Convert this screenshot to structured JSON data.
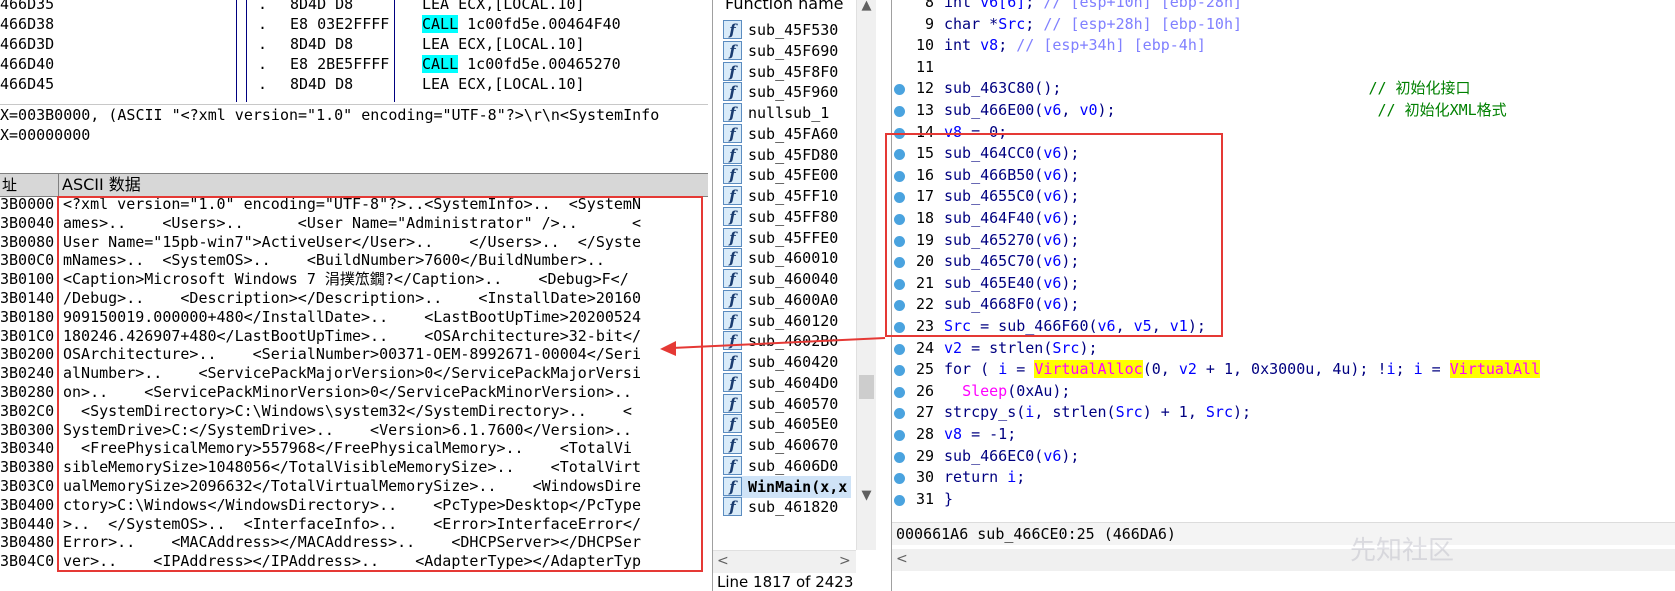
{
  "disasm": [
    {
      "addr": "466D35",
      "mark": ".",
      "bytes": "8D4D D8",
      "mnemonic": "LEA",
      "operands": "ECX,[LOCAL.10]",
      "call": false
    },
    {
      "addr": "466D38",
      "mark": ".",
      "bytes": "E8 03E2FFFF",
      "mnemonic": "CALL",
      "operands": "1c00fd5e.00464F40",
      "call": true
    },
    {
      "addr": "466D3D",
      "mark": ".",
      "bytes": "8D4D D8",
      "mnemonic": "LEA",
      "operands": "ECX,[LOCAL.10]",
      "call": false
    },
    {
      "addr": "466D40",
      "mark": ".",
      "bytes": "E8 2BE5FFFF",
      "mnemonic": "CALL",
      "operands": "1c00fd5e.00465270",
      "call": true
    },
    {
      "addr": "466D45",
      "mark": ".",
      "bytes": "8D4D D8",
      "mnemonic": "LEA",
      "operands": "ECX,[LOCAL.10]",
      "call": false
    }
  ],
  "info": {
    "line1": "X=003B0000, (ASCII \"<?xml version=\"1.0\" encoding=\"UTF-8\"?>\\r\\n<SystemInfo",
    "line2": "X=00000000"
  },
  "dump_header": {
    "addr": "址",
    "ascii": "ASCII 数据"
  },
  "dump": [
    {
      "addr": "3B0000",
      "text": "<?xml version=\"1.0\" encoding=\"UTF-8\"?>..<SystemInfo>..  <SystemN"
    },
    {
      "addr": "3B0040",
      "text": "ames>..    <Users>..      <User Name=\"Administrator\" />..      <"
    },
    {
      "addr": "3B0080",
      "text": "User Name=\"15pb-win7\">ActiveUser</User>..    </Users>..  </Syste"
    },
    {
      "addr": "3B00C0",
      "text": "mNames>..  <SystemOS>..    <BuildNumber>7600</BuildNumber>..    "
    },
    {
      "addr": "3B0100",
      "text": "<Caption>Microsoft Windows 7 涓撲笟鐗?</Caption>..    <Debug>F</"
    },
    {
      "addr": "3B0140",
      "text": "/Debug>..    <Description></Description>..    <InstallDate>20160"
    },
    {
      "addr": "3B0180",
      "text": "909150019.000000+480</InstallDate>..    <LastBootUpTime>20200524"
    },
    {
      "addr": "3B01C0",
      "text": "180246.426907+480</LastBootUpTime>..    <OSArchitecture>32-bit</"
    },
    {
      "addr": "3B0200",
      "text": "OSArchitecture>..    <SerialNumber>00371-OEM-8992671-00004</Seri"
    },
    {
      "addr": "3B0240",
      "text": "alNumber>..    <ServicePackMajorVersion>0</ServicePackMajorVersi"
    },
    {
      "addr": "3B0280",
      "text": "on>..    <ServicePackMinorVersion>0</ServicePackMinorVersion>..  "
    },
    {
      "addr": "3B02C0",
      "text": "  <SystemDirectory>C:\\Windows\\system32</SystemDirectory>..    <"
    },
    {
      "addr": "3B0300",
      "text": "SystemDrive>C:</SystemDrive>..    <Version>6.1.7600</Version>..  "
    },
    {
      "addr": "3B0340",
      "text": "  <FreePhysicalMemory>557968</FreePhysicalMemory>..    <TotalVi"
    },
    {
      "addr": "3B0380",
      "text": "sibleMemorySize>1048056</TotalVisibleMemorySize>..    <TotalVirt"
    },
    {
      "addr": "3B03C0",
      "text": "ualMemorySize>2096632</TotalVirtualMemorySize>..    <WindowsDire"
    },
    {
      "addr": "3B0400",
      "text": "ctory>C:\\Windows</WindowsDirectory>..    <PcType>Desktop</PcType"
    },
    {
      "addr": "3B0440",
      "text": ">..  </SystemOS>..  <InterfaceInfo>..    <Error>InterfaceError</"
    },
    {
      "addr": "3B0480",
      "text": "Error>..    <MACAddress></MACAddress>..    <DHCPServer></DHCPSer"
    },
    {
      "addr": "3B04C0",
      "text": "ver>..    <IPAddress></IPAddress>..    <AdapterType></AdapterTyp"
    }
  ],
  "functions": {
    "header": "Function name",
    "items": [
      "sub_45F530",
      "sub_45F690",
      "sub_45F8F0",
      "sub_45F960",
      "nullsub_1",
      "sub_45FA60",
      "sub_45FD80",
      "sub_45FE00",
      "sub_45FF10",
      "sub_45FF80",
      "sub_45FFE0",
      "sub_460010",
      "sub_460040",
      "sub_4600A0",
      "sub_460120",
      "sub_4602B0",
      "sub_460420",
      "sub_4604D0",
      "sub_460570",
      "sub_4605E0",
      "sub_460670",
      "sub_4606D0",
      "WinMain(x,x",
      "sub_461820"
    ],
    "selected": "WinMain(x,x",
    "status": "Line 1817 of 2423"
  },
  "code_lines": [
    {
      "num": "8",
      "dot": false,
      "segs": [
        [
          "",
          "int "
        ],
        [
          "v",
          "v6[6]"
        ],
        [
          "",
          ";"
        ],
        [
          "c",
          " // [esp+10h] [ebp-28h]"
        ]
      ]
    },
    {
      "num": "9",
      "dot": false,
      "segs": [
        [
          "",
          "char *"
        ],
        [
          "v",
          "Src"
        ],
        [
          "",
          ";"
        ],
        [
          "c",
          " // [esp+28h] [ebp-10h]"
        ]
      ]
    },
    {
      "num": "10",
      "dot": false,
      "segs": [
        [
          "",
          "int "
        ],
        [
          "v",
          "v8"
        ],
        [
          "",
          ";"
        ],
        [
          "c",
          " // [esp+34h] [ebp-4h]"
        ]
      ]
    },
    {
      "num": "11",
      "dot": false,
      "segs": []
    },
    {
      "num": "12",
      "dot": true,
      "segs": [
        [
          "",
          "sub_463C80();                                  "
        ],
        [
          "c",
          "// 初始化接口"
        ]
      ]
    },
    {
      "num": "13",
      "dot": true,
      "segs": [
        [
          "",
          "sub_466E00("
        ],
        [
          "v",
          "v6"
        ],
        [
          "",
          ", "
        ],
        [
          "v",
          "v0"
        ],
        [
          "",
          ");                             "
        ],
        [
          "c",
          "// 初始化XML格式"
        ]
      ]
    },
    {
      "num": "14",
      "dot": true,
      "segs": [
        [
          "v",
          "v8"
        ],
        [
          "",
          " = 0;"
        ]
      ]
    },
    {
      "num": "15",
      "dot": true,
      "segs": [
        [
          "",
          "sub_464CC0("
        ],
        [
          "v",
          "v6"
        ],
        [
          "",
          ");"
        ]
      ]
    },
    {
      "num": "16",
      "dot": true,
      "segs": [
        [
          "",
          "sub_466B50("
        ],
        [
          "v",
          "v6"
        ],
        [
          "",
          ");"
        ]
      ]
    },
    {
      "num": "17",
      "dot": true,
      "segs": [
        [
          "",
          "sub_4655C0("
        ],
        [
          "v",
          "v6"
        ],
        [
          "",
          ");"
        ]
      ]
    },
    {
      "num": "18",
      "dot": true,
      "segs": [
        [
          "",
          "sub_464F40("
        ],
        [
          "v",
          "v6"
        ],
        [
          "",
          ");"
        ]
      ]
    },
    {
      "num": "19",
      "dot": true,
      "segs": [
        [
          "",
          "sub_465270("
        ],
        [
          "v",
          "v6"
        ],
        [
          "",
          ");"
        ]
      ]
    },
    {
      "num": "20",
      "dot": true,
      "segs": [
        [
          "",
          "sub_465C70("
        ],
        [
          "v",
          "v6"
        ],
        [
          "",
          ");"
        ]
      ]
    },
    {
      "num": "21",
      "dot": true,
      "segs": [
        [
          "",
          "sub_465E40("
        ],
        [
          "v",
          "v6"
        ],
        [
          "",
          ");"
        ]
      ]
    },
    {
      "num": "22",
      "dot": true,
      "segs": [
        [
          "",
          "sub_4668F0("
        ],
        [
          "v",
          "v6"
        ],
        [
          "",
          ");"
        ]
      ]
    },
    {
      "num": "23",
      "dot": true,
      "segs": [
        [
          "v",
          "Src"
        ],
        [
          "",
          " = sub_466F60("
        ],
        [
          "v",
          "v6"
        ],
        [
          "",
          ", "
        ],
        [
          "v",
          "v5"
        ],
        [
          "",
          ", "
        ],
        [
          "v",
          "v1"
        ],
        [
          "",
          ");"
        ]
      ]
    },
    {
      "num": "24",
      "dot": true,
      "segs": [
        [
          "v",
          "v2"
        ],
        [
          "",
          " = strlen("
        ],
        [
          "v",
          "Src"
        ],
        [
          "",
          ");"
        ]
      ]
    },
    {
      "num": "25",
      "dot": true,
      "segs": [
        [
          "",
          "for ( "
        ],
        [
          "v",
          "i"
        ],
        [
          "",
          " = "
        ],
        [
          "a",
          "VirtualAlloc"
        ],
        [
          "",
          "(0, "
        ],
        [
          "v",
          "v2"
        ],
        [
          "",
          " + 1, 0x3000u, 4u); !"
        ],
        [
          "v",
          "i"
        ],
        [
          "",
          "; "
        ],
        [
          "v",
          "i"
        ],
        [
          "",
          " = "
        ],
        [
          "a",
          "VirtualAll"
        ]
      ]
    },
    {
      "num": "26",
      "dot": true,
      "segs": [
        [
          "",
          "  "
        ],
        [
          "s",
          "Sleep"
        ],
        [
          "",
          "(0xAu);"
        ]
      ]
    },
    {
      "num": "27",
      "dot": true,
      "segs": [
        [
          "",
          "strcpy_s("
        ],
        [
          "v",
          "i"
        ],
        [
          "",
          ", strlen("
        ],
        [
          "v",
          "Src"
        ],
        [
          "",
          ") + 1, "
        ],
        [
          "v",
          "Src"
        ],
        [
          "",
          ");"
        ]
      ]
    },
    {
      "num": "28",
      "dot": true,
      "segs": [
        [
          "v",
          "v8"
        ],
        [
          "",
          " = -1;"
        ]
      ]
    },
    {
      "num": "29",
      "dot": true,
      "segs": [
        [
          "",
          "sub_466EC0("
        ],
        [
          "v",
          "v6"
        ],
        [
          "",
          ");"
        ]
      ]
    },
    {
      "num": "30",
      "dot": true,
      "segs": [
        [
          "",
          "return "
        ],
        [
          "v",
          "i"
        ],
        [
          "",
          ";"
        ]
      ]
    },
    {
      "num": "31",
      "dot": true,
      "segs": [
        [
          "",
          "}"
        ]
      ]
    }
  ],
  "code_status": "000661A6 sub_466CE0:25 (466DA6)",
  "watermark": "先知社区",
  "colors": {
    "highlight_box": "#e53935",
    "call_bg": "#00ffff",
    "api_bg": "#ffff00",
    "comment": "#008000",
    "variable": "#0000ff"
  }
}
